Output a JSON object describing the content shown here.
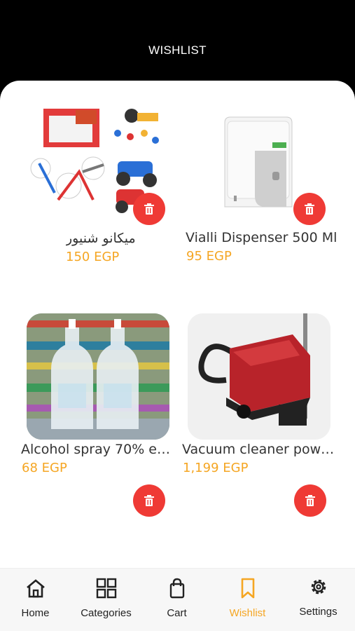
{
  "header": {
    "title": "WISHLIST"
  },
  "items": [
    {
      "name": "ميكانو شنيور",
      "price": "150 EGP",
      "image_icon": "toy-construction-set-image"
    },
    {
      "name": "Vialli Dispenser 500 Ml",
      "price": "95 EGP",
      "image_icon": "soap-dispenser-image"
    },
    {
      "name": "Alcohol spray 70% eas...",
      "price": "68 EGP",
      "image_icon": "alcohol-spray-bottles-image"
    },
    {
      "name": "Vacuum cleaner powe...",
      "price": "1,199 EGP",
      "image_icon": "vacuum-cleaner-image"
    }
  ],
  "tabs": [
    {
      "label": "Home",
      "icon": "home-icon"
    },
    {
      "label": "Categories",
      "icon": "grid-icon"
    },
    {
      "label": "Cart",
      "icon": "shopping-bag-icon"
    },
    {
      "label": "Wishlist",
      "icon": "bookmark-icon"
    },
    {
      "label": "Settings",
      "icon": "gear-icon"
    }
  ],
  "colors": {
    "accent": "#f5a623",
    "delete": "#ef3a35",
    "header_bg": "#000000"
  }
}
